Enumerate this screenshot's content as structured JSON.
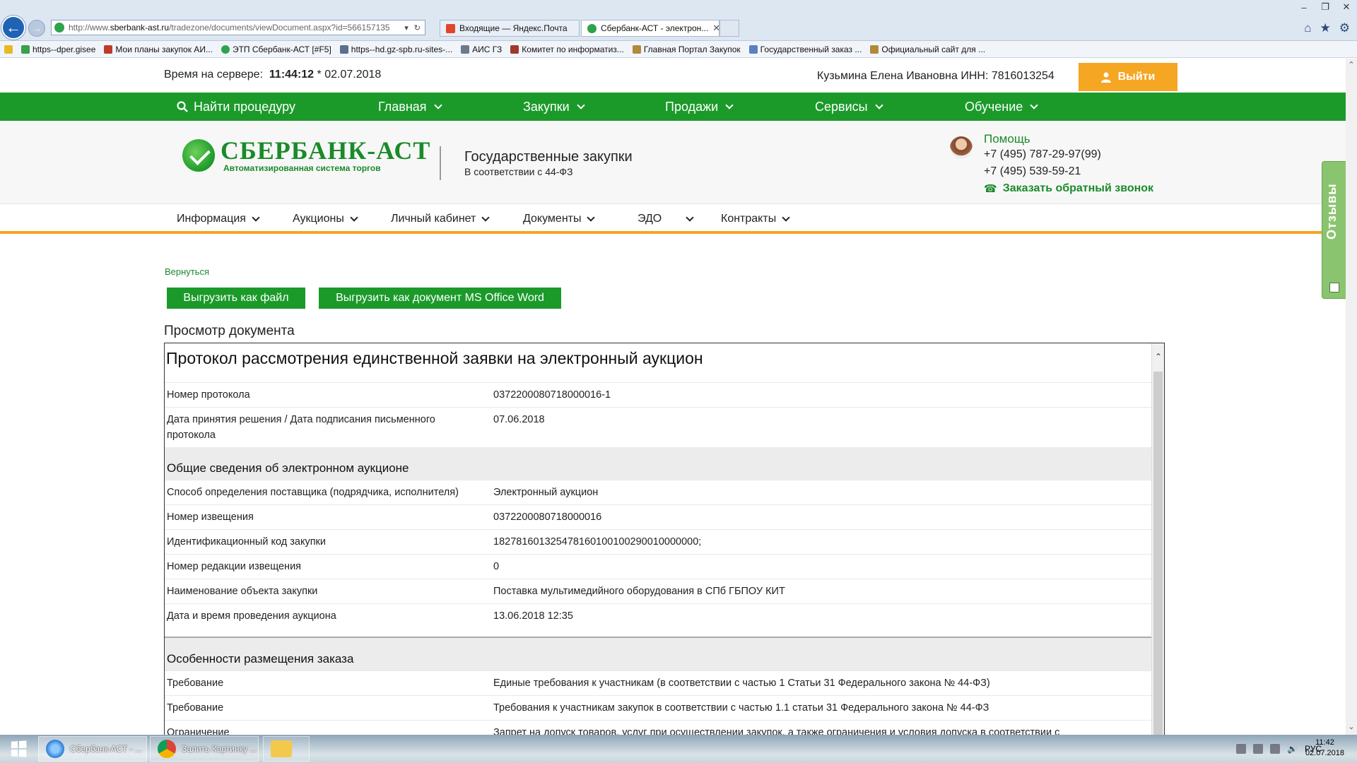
{
  "browser": {
    "address": {
      "prefix": "http://www.",
      "host": "sberbank-ast.ru",
      "path": "/tradezone/documents/viewDocument.aspx?id=566157135"
    },
    "tabs": [
      {
        "label": "Входящие — Яндекс.Почта",
        "color": "#e2452b"
      },
      {
        "label": "Сбербанк-АСТ - электрон...",
        "color": "#2fa34a"
      }
    ],
    "favorites": [
      {
        "label": "https--dper.gisee",
        "color": "#3aa04a"
      },
      {
        "label": "Мои планы закупок  АИ...",
        "color": "#c0392b"
      },
      {
        "label": "ЭТП Сбербанк-АСТ [#F5]",
        "color": "#2fa34a"
      },
      {
        "label": "https--hd.gz-spb.ru-sites-...",
        "color": "#5b6e8c"
      },
      {
        "label": "АИС ГЗ",
        "color": "#6c7a8a"
      },
      {
        "label": "Комитет по информатиз...",
        "color": "#a0392b"
      },
      {
        "label": "Главная Портал Закупок",
        "color": "#b08a3a"
      },
      {
        "label": "Государственный заказ ...",
        "color": "#5b7fbf"
      },
      {
        "label": "Официальный сайт для ...",
        "color": "#b08a3a"
      }
    ]
  },
  "site": {
    "server_time_label": "Время на сервере:",
    "server_time": "11:44:12",
    "server_date": "* 02.07.2018",
    "user": "Кузьмина Елена Ивановна ИНН: 7816013254",
    "logout": "Выйти",
    "main_nav": [
      "Найти процедуру",
      "Главная",
      "Закупки",
      "Продажи",
      "Сервисы",
      "Обучение"
    ],
    "logo_big": "СБЕРБАНК-АСТ",
    "logo_small": "Автоматизированная система торгов",
    "section_title": "Государственные закупки",
    "section_sub": "В соответствии с 44-ФЗ",
    "help": "Помощь",
    "phone1": "+7 (495) 787-29-97(99)",
    "phone2": "+7 (495) 539-59-21",
    "callback": "Заказать обратный звонок",
    "sub_nav": [
      "Информация",
      "Аукционы",
      "Личный кабинет",
      "Документы",
      "ЭДО",
      "Контракты"
    ],
    "feedback": "Отзывы",
    "back_link": "Вернуться",
    "export_file": "Выгрузить как файл",
    "export_word": "Выгрузить как документ MS Office Word",
    "doc_view_title": "Просмотр документа"
  },
  "document": {
    "title": "Протокол рассмотрения единственной заявки на электронный аукцион",
    "rows_top": [
      {
        "label": "Номер протокола",
        "value": "0372200080718000016-1"
      },
      {
        "label": "Дата принятия решения / Дата подписания письменного протокола",
        "value": "07.06.2018"
      }
    ],
    "section1": "Общие сведения об электронном аукционе",
    "rows_s1": [
      {
        "label": "Способ определения поставщика (подрядчика, исполнителя)",
        "value": "Электронный аукцион"
      },
      {
        "label": "Номер извещения",
        "value": "0372200080718000016"
      },
      {
        "label": "Идентификационный код закупки",
        "value": "182781601325478160100100290010000000;"
      },
      {
        "label": "Номер редакции извещения",
        "value": "0"
      },
      {
        "label": "Наименование объекта закупки",
        "value": "Поставка мультимедийного оборудования в СПб ГБПОУ КИТ"
      },
      {
        "label": "Дата и время проведения аукциона",
        "value": "13.06.2018 12:35"
      }
    ],
    "section2": "Особенности размещения заказа",
    "rows_s2": [
      {
        "label": "Требование",
        "value": "Единые требования к участникам (в соответствии с частью 1 Статьи 31 Федерального закона № 44-ФЗ)"
      },
      {
        "label": "Требование",
        "value": "Требования к участникам закупок в соответствии с частью 1.1 статьи 31 Федерального закона № 44-ФЗ"
      },
      {
        "label": "Ограничение",
        "value": "Запрет на допуск товаров, услуг при осуществлении закупок, а также ограничения и условия допуска в соответствии с"
      }
    ]
  },
  "taskbar": {
    "items": [
      {
        "label": "Сбербанк-АСТ - ...",
        "color": "#2b7bd6"
      },
      {
        "label": "Залить Картинку ...",
        "color": "#db4437"
      }
    ],
    "lang": "РУС",
    "time": "11:42",
    "date": "02.07.2018"
  },
  "colors": {
    "brand_green": "#1b9a2a",
    "accent_orange": "#f5a623"
  }
}
